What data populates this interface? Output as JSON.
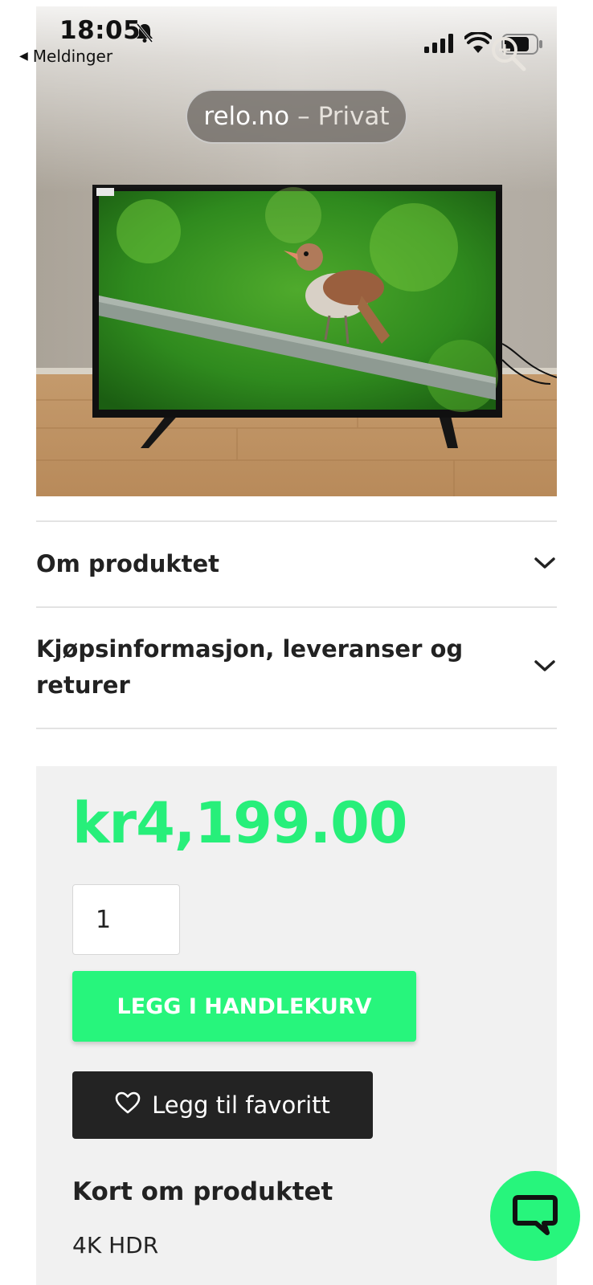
{
  "status_bar": {
    "time": "18:05",
    "back_label": "Meldinger"
  },
  "browser": {
    "domain": "relo.no",
    "separator": "–",
    "mode": "Privat"
  },
  "accordions": [
    {
      "title": "Om produktet"
    },
    {
      "title": "Kjøpsinformasjon, leveranser og returer"
    }
  ],
  "product": {
    "price": "kr4,199.00",
    "quantity": "1",
    "add_to_cart_label": "LEGG I HANDLEKURV",
    "favorite_label": "Legg til favoritt",
    "summary_heading": "Kort om produktet",
    "summary_text": "4K HDR"
  },
  "colors": {
    "accent": "#27f57c",
    "price": "#27ef7a",
    "dark_button": "#232323",
    "panel_bg": "#f1f1f1"
  },
  "icons": {
    "bell": "bell-slash-icon",
    "zoom": "zoom-in-icon",
    "chevron": "chevron-down-icon",
    "heart": "heart-icon",
    "chat": "chat-bubble-icon"
  }
}
